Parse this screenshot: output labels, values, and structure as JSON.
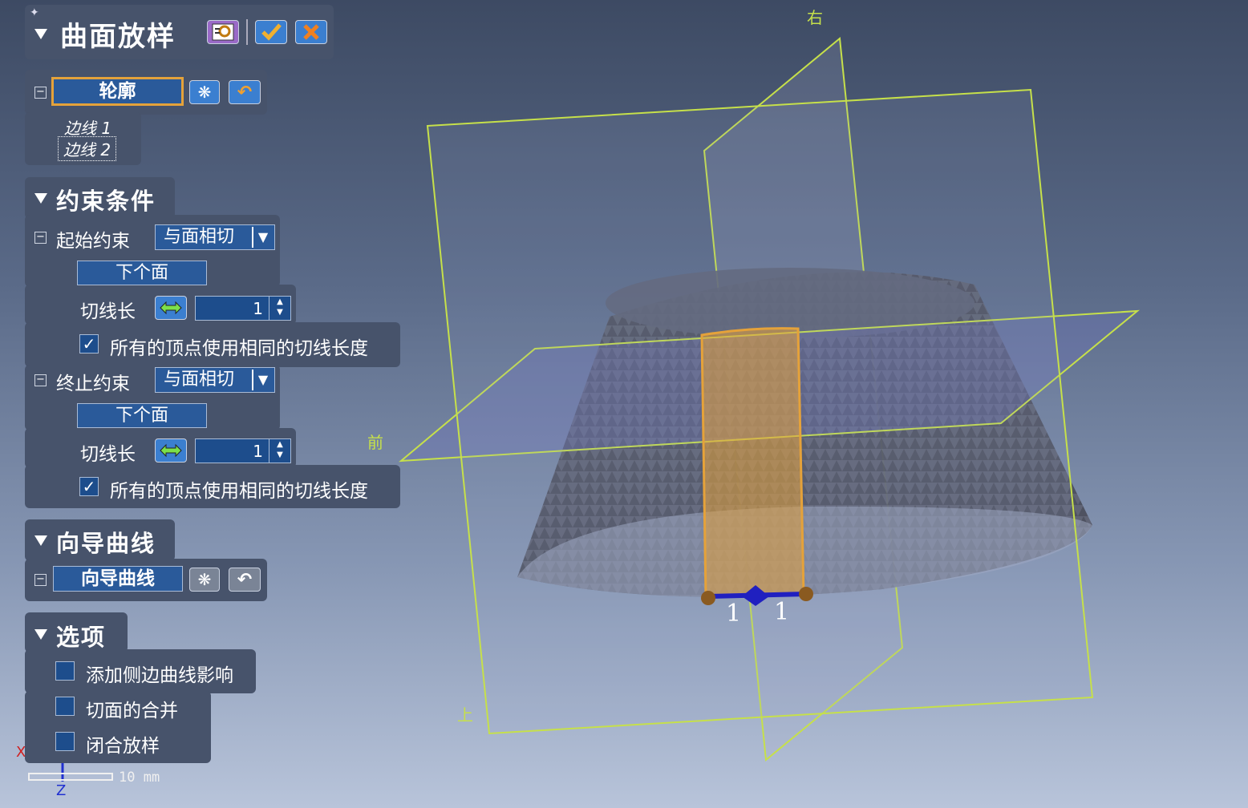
{
  "header": {
    "title": "曲面放样"
  },
  "profile": {
    "button_label": "轮廓",
    "edges": [
      "边线 1",
      "边线 2"
    ]
  },
  "constraints": {
    "title": "约束条件",
    "start": {
      "label": "起始约束",
      "type": "与面相切",
      "next_face": "下个面",
      "tangent_label": "切线长",
      "tangent_value": "1",
      "same_length_label": "所有的顶点使用相同的切线长度",
      "same_length_checked": true
    },
    "end": {
      "label": "终止约束",
      "type": "与面相切",
      "next_face": "下个面",
      "tangent_label": "切线长",
      "tangent_value": "1",
      "same_length_label": "所有的顶点使用相同的切线长度",
      "same_length_checked": true
    }
  },
  "guide": {
    "title": "向导曲线",
    "button_label": "向导曲线"
  },
  "options": {
    "title": "选项",
    "items": [
      {
        "label": "添加侧边曲线影响",
        "checked": false
      },
      {
        "label": "切面的合并",
        "checked": false
      },
      {
        "label": "闭合放样",
        "checked": false
      }
    ]
  },
  "viewport": {
    "plane_labels": {
      "right": "右",
      "front": "前",
      "top": "上"
    },
    "marker_labels": [
      "1",
      "1"
    ],
    "scale_label": "10 mm",
    "triad": {
      "x": "X",
      "z": "Z"
    }
  },
  "colors": {
    "panel": "#47536b",
    "accent_orange": "#e5a23a",
    "plane": "#c6e04a",
    "handle": "#2020c0"
  }
}
